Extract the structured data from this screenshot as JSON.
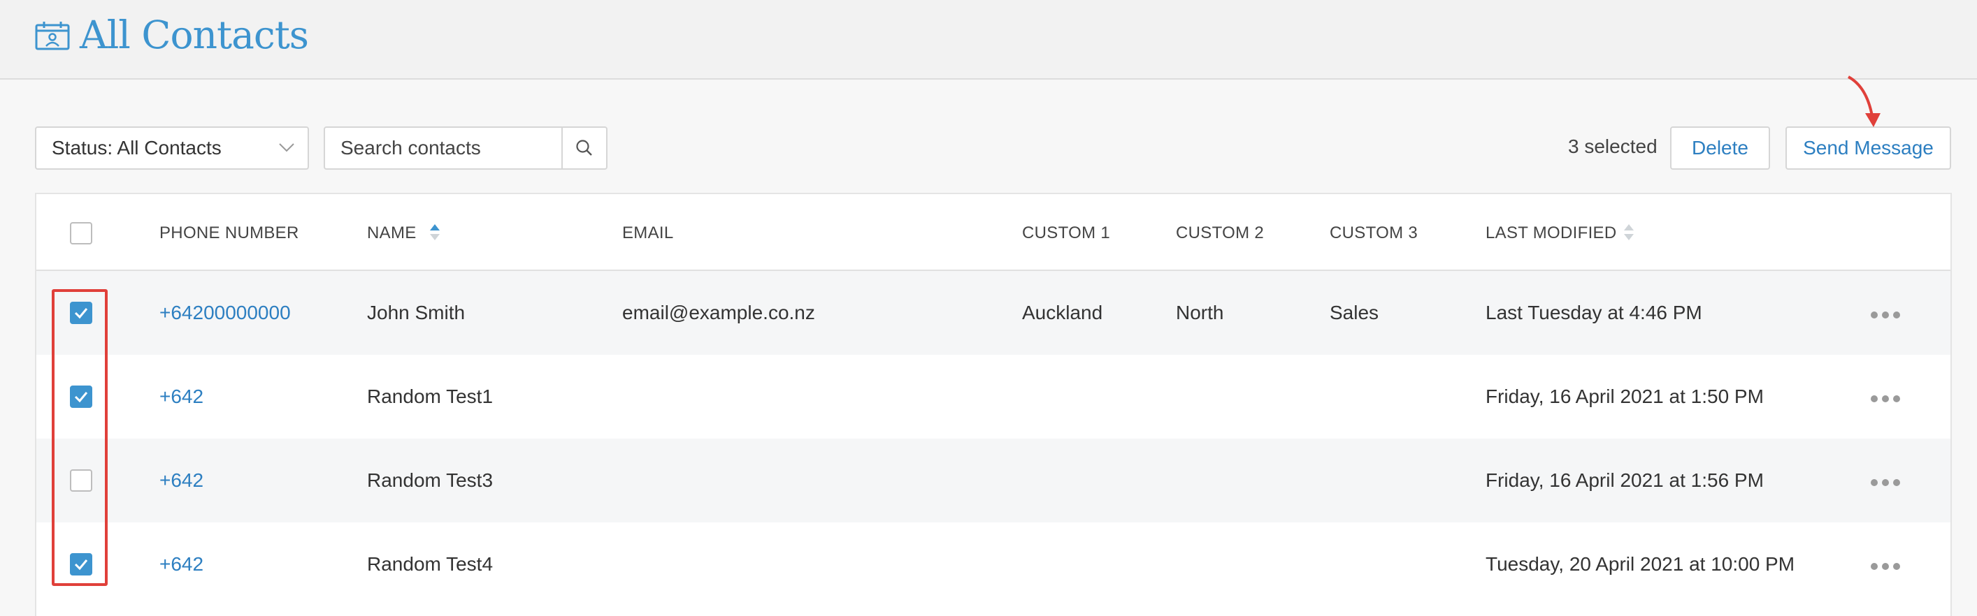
{
  "header": {
    "title": "All Contacts",
    "icon": "calendar-contact-icon"
  },
  "toolbar": {
    "status_filter": "Status: All Contacts",
    "search_placeholder": "Search contacts",
    "selected_count": "3 selected",
    "delete_label": "Delete",
    "send_message_label": "Send Message"
  },
  "table": {
    "columns": {
      "phone": "PHONE NUMBER",
      "name": "NAME",
      "email": "EMAIL",
      "custom1": "CUSTOM 1",
      "custom2": "CUSTOM 2",
      "custom3": "CUSTOM 3",
      "last_modified": "LAST MODIFIED"
    },
    "rows": [
      {
        "selected": true,
        "phone": "+64200000000",
        "name": "John Smith",
        "email": "email@example.co.nz",
        "custom1": "Auckland",
        "custom2": "North",
        "custom3": "Sales",
        "last_modified": "Last Tuesday at 4:46 PM"
      },
      {
        "selected": true,
        "phone": "+642",
        "name": "Random Test1",
        "email": "",
        "custom1": "",
        "custom2": "",
        "custom3": "",
        "last_modified": "Friday, 16 April 2021 at 1:50 PM"
      },
      {
        "selected": false,
        "phone": "+642",
        "name": "Random Test3",
        "email": "",
        "custom1": "",
        "custom2": "",
        "custom3": "",
        "last_modified": "Friday, 16 April 2021 at 1:56 PM"
      },
      {
        "selected": true,
        "phone": "+642",
        "name": "Random Test4",
        "email": "",
        "custom1": "",
        "custom2": "",
        "custom3": "",
        "last_modified": "Tuesday, 20 April 2021 at 10:00 PM"
      }
    ]
  },
  "colors": {
    "accent": "#3d94cf",
    "link": "#2d7fc1",
    "annotation": "#e0403a"
  }
}
